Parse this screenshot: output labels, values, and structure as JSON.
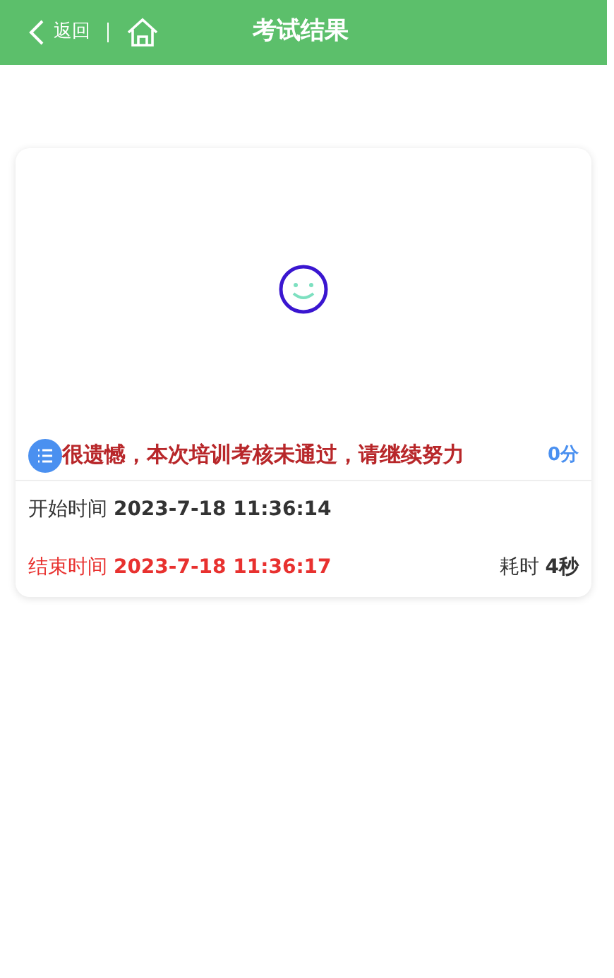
{
  "header": {
    "back_label": "返回",
    "title": "考试结果"
  },
  "result": {
    "message": "很遗憾，本次培训考核未通过，请继续努力",
    "score": "0分"
  },
  "start_time": {
    "label": "开始时间",
    "value": "2023-7-18 11:36:14"
  },
  "end_time": {
    "label": "结束时间",
    "value": "2023-7-18 11:36:17"
  },
  "duration": {
    "label": "耗时",
    "value": "4秒"
  }
}
